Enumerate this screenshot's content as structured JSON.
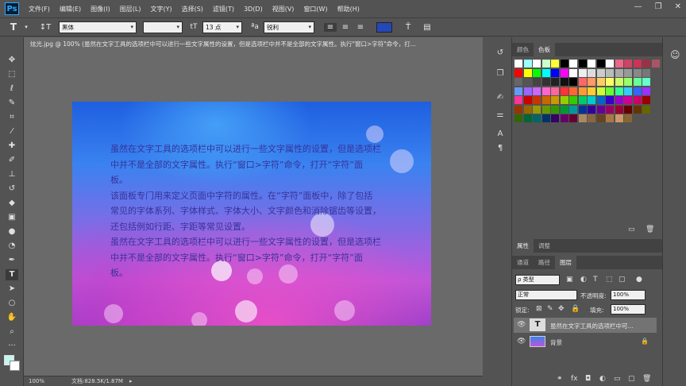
{
  "app": {
    "logo": "Ps"
  },
  "menu": [
    "文件(F)",
    "编辑(E)",
    "图像(I)",
    "图层(L)",
    "文字(Y)",
    "选择(S)",
    "滤镜(T)",
    "3D(D)",
    "视图(V)",
    "窗口(W)",
    "帮助(H)"
  ],
  "window_controls": {
    "minimize": "—",
    "restore": "❐",
    "close": "✕"
  },
  "options": {
    "font_family": "黑体",
    "font_style": "",
    "font_size": "13 点",
    "antialias": "锐利",
    "text_color": "#2548b8"
  },
  "document": {
    "tab_title": "炫光.jpg @ 100% (虽然在文字工具的选项栏中可以进行一些文字属性的设置，但是选项栏中并不是全部的文字属性。执行\"窗口>字符\"命令，打...",
    "zoom": "100%",
    "doc_size": "文档:828.5K/1.87M",
    "text_lines": [
      "虽然在文字工具的选项栏中可以进行一些文字属性的设置，但是选项栏",
      "中并不是全部的文字属性。执行“窗口>字符”命令，打开“字符”面",
      "板。",
      "该面板专门用来定义页面中字符的属性。在“字符”面板中，除了包括",
      "常见的字体系列、字体样式、字体大小、文字颜色和消除锯齿等设置，",
      "还包括例如行距、字距等常见设置。",
      "虽然在文字工具的选项栏中可以进行一些文字属性的设置，但是选项栏",
      "中并不是全部的文字属性。执行“窗口>字符”命令，打开“字符”面",
      "板。"
    ]
  },
  "panels": {
    "color_tabs": [
      "颜色",
      "色板"
    ],
    "props_tabs": [
      "属性",
      "调整"
    ],
    "layers_tabs": [
      "通道",
      "路径",
      "图层"
    ],
    "filter_kind": "ρ 类型",
    "blend_mode": "正常",
    "opacity_label": "不透明度:",
    "opacity_value": "100%",
    "lock_label": "锁定:",
    "fill_label": "填充:",
    "fill_value": "100%",
    "layers": [
      {
        "name": "虽然在文字工具的选项栏中可...",
        "type": "text",
        "selected": true
      },
      {
        "name": "背景",
        "type": "image",
        "selected": false
      }
    ]
  },
  "swatches_colors": [
    [
      "#ffffff",
      "#99ffff",
      "#ffffff",
      "#ccffcc",
      "#ffff33",
      "#000000",
      "#ffffff",
      "#000000",
      "#ffffff",
      "#000000",
      "#ffffff",
      "#ee6688",
      "#cc4466",
      "#cc3355",
      "#993344",
      "#aa5566"
    ],
    [
      "#ff0000",
      "#ffff00",
      "#00ff00",
      "#00ffff",
      "#0000ff",
      "#ff00ff",
      "#ffffff",
      "#eeeeee",
      "#dddddd",
      "#cccccc",
      "#bbbbbb",
      "#aaaaaa",
      "#999999",
      "#888888",
      "#777777"
    ],
    [
      "#666666",
      "#555555",
      "#444444",
      "#333333",
      "#222222",
      "#111111",
      "#000000",
      "#ff6666",
      "#ff9966",
      "#ffcc66",
      "#ffff66",
      "#ccff66",
      "#99ff66",
      "#66ff99",
      "#66ffcc"
    ],
    [
      "#6699ff",
      "#9966ff",
      "#cc66ff",
      "#ff66cc",
      "#ff6699",
      "#ff3333",
      "#ff6633",
      "#ff9933",
      "#ffcc33",
      "#ccff33",
      "#66ff33",
      "#33ff99",
      "#33ccff",
      "#3366ff",
      "#9933ff"
    ],
    [
      "#ff3399",
      "#cc0000",
      "#cc3300",
      "#cc6600",
      "#cc9900",
      "#99cc00",
      "#33cc00",
      "#00cc66",
      "#00cccc",
      "#0066cc",
      "#3300cc",
      "#9900cc",
      "#cc0099",
      "#cc0066",
      "#990000"
    ],
    [
      "#993300",
      "#996600",
      "#999900",
      "#669900",
      "#339900",
      "#009933",
      "#009999",
      "#003399",
      "#330099",
      "#660099",
      "#990066",
      "#990033",
      "#660000",
      "#663300",
      "#666600"
    ],
    [
      "#336600",
      "#006633",
      "#006666",
      "#003366",
      "#330066",
      "#660066",
      "#660033",
      "#aa8866",
      "#886644",
      "#664422",
      "#aa7744",
      "#cc9966",
      "#886633"
    ]
  ]
}
